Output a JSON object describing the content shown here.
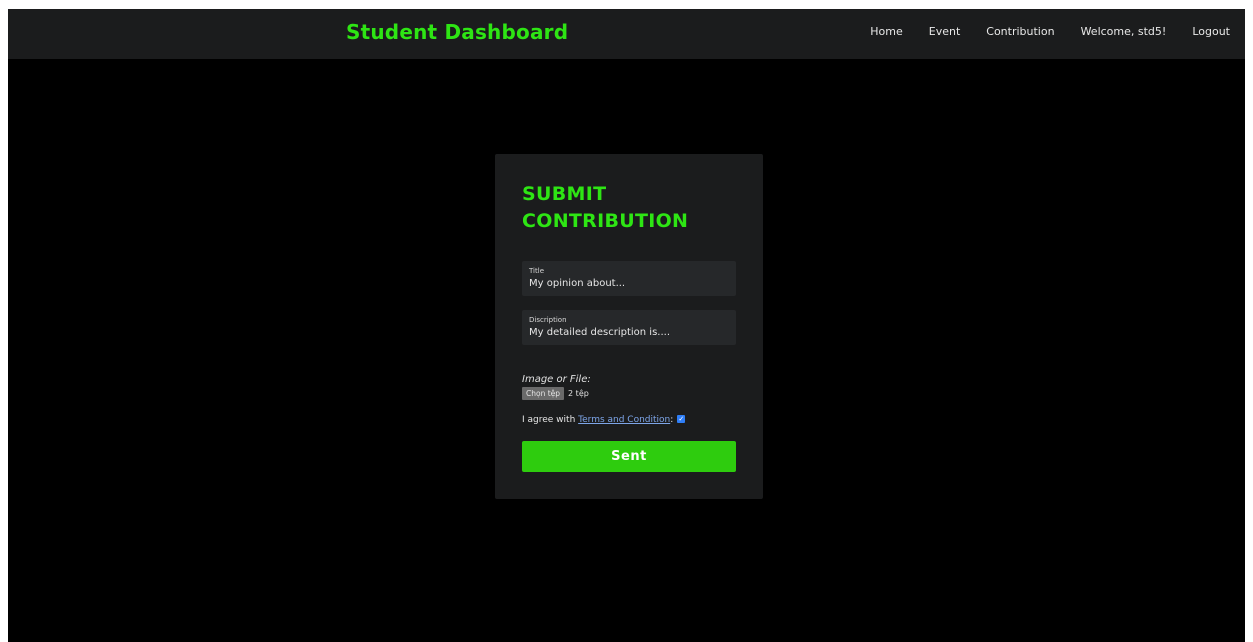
{
  "navbar": {
    "brand": "Student Dashboard",
    "links": [
      "Home",
      "Event",
      "Contribution",
      "Welcome, std5!",
      "Logout"
    ]
  },
  "form": {
    "title": "SUBMIT CONTRIBUTION",
    "title_field": {
      "label": "Title",
      "placeholder": "My opinion about..."
    },
    "description_field": {
      "label": "Discription",
      "placeholder": "My detailed description is...."
    },
    "file": {
      "label": "Image or File:",
      "button_label": "Chọn tệp",
      "status": "2 tệp"
    },
    "agreement": {
      "prefix": "I agree with ",
      "link_text": "Terms and Condition",
      "suffix": ":",
      "checked": true
    },
    "submit_label": "Sent"
  },
  "colors": {
    "accent": "#2ee514",
    "button": "#2ecc0e",
    "background": "#000000",
    "panel": "#1b1c1d",
    "link": "#7da5e8"
  }
}
